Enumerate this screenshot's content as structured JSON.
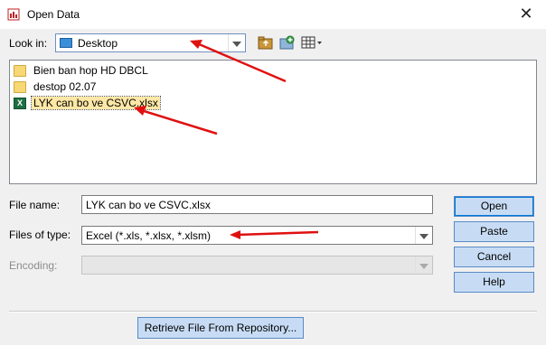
{
  "window": {
    "title": "Open Data"
  },
  "look_in": {
    "label": "Look in:",
    "value": "Desktop"
  },
  "toolbar": {
    "up_icon": "up-folder-icon",
    "new_folder_icon": "new-folder-icon",
    "view_icon": "view-menu-icon"
  },
  "files": [
    {
      "name": "Bien ban hop HD DBCL",
      "type": "folder"
    },
    {
      "name": "destop 02.07",
      "type": "folder"
    },
    {
      "name": "LYK can bo ve CSVC.xlsx",
      "type": "excel",
      "selected": true
    }
  ],
  "file_name": {
    "label": "File name:",
    "value": "LYK can bo ve CSVC.xlsx"
  },
  "files_of_type": {
    "label": "Files of type:",
    "value": "Excel (*.xls, *.xlsx, *.xlsm)"
  },
  "encoding": {
    "label": "Encoding:",
    "value": ""
  },
  "buttons": {
    "open": "Open",
    "paste": "Paste",
    "cancel": "Cancel",
    "help": "Help",
    "retrieve": "Retrieve File From Repository..."
  },
  "colors": {
    "annotation_arrow": "#e01010",
    "primary_button": "#c7dcf4",
    "selection": "#ffe8a6"
  }
}
